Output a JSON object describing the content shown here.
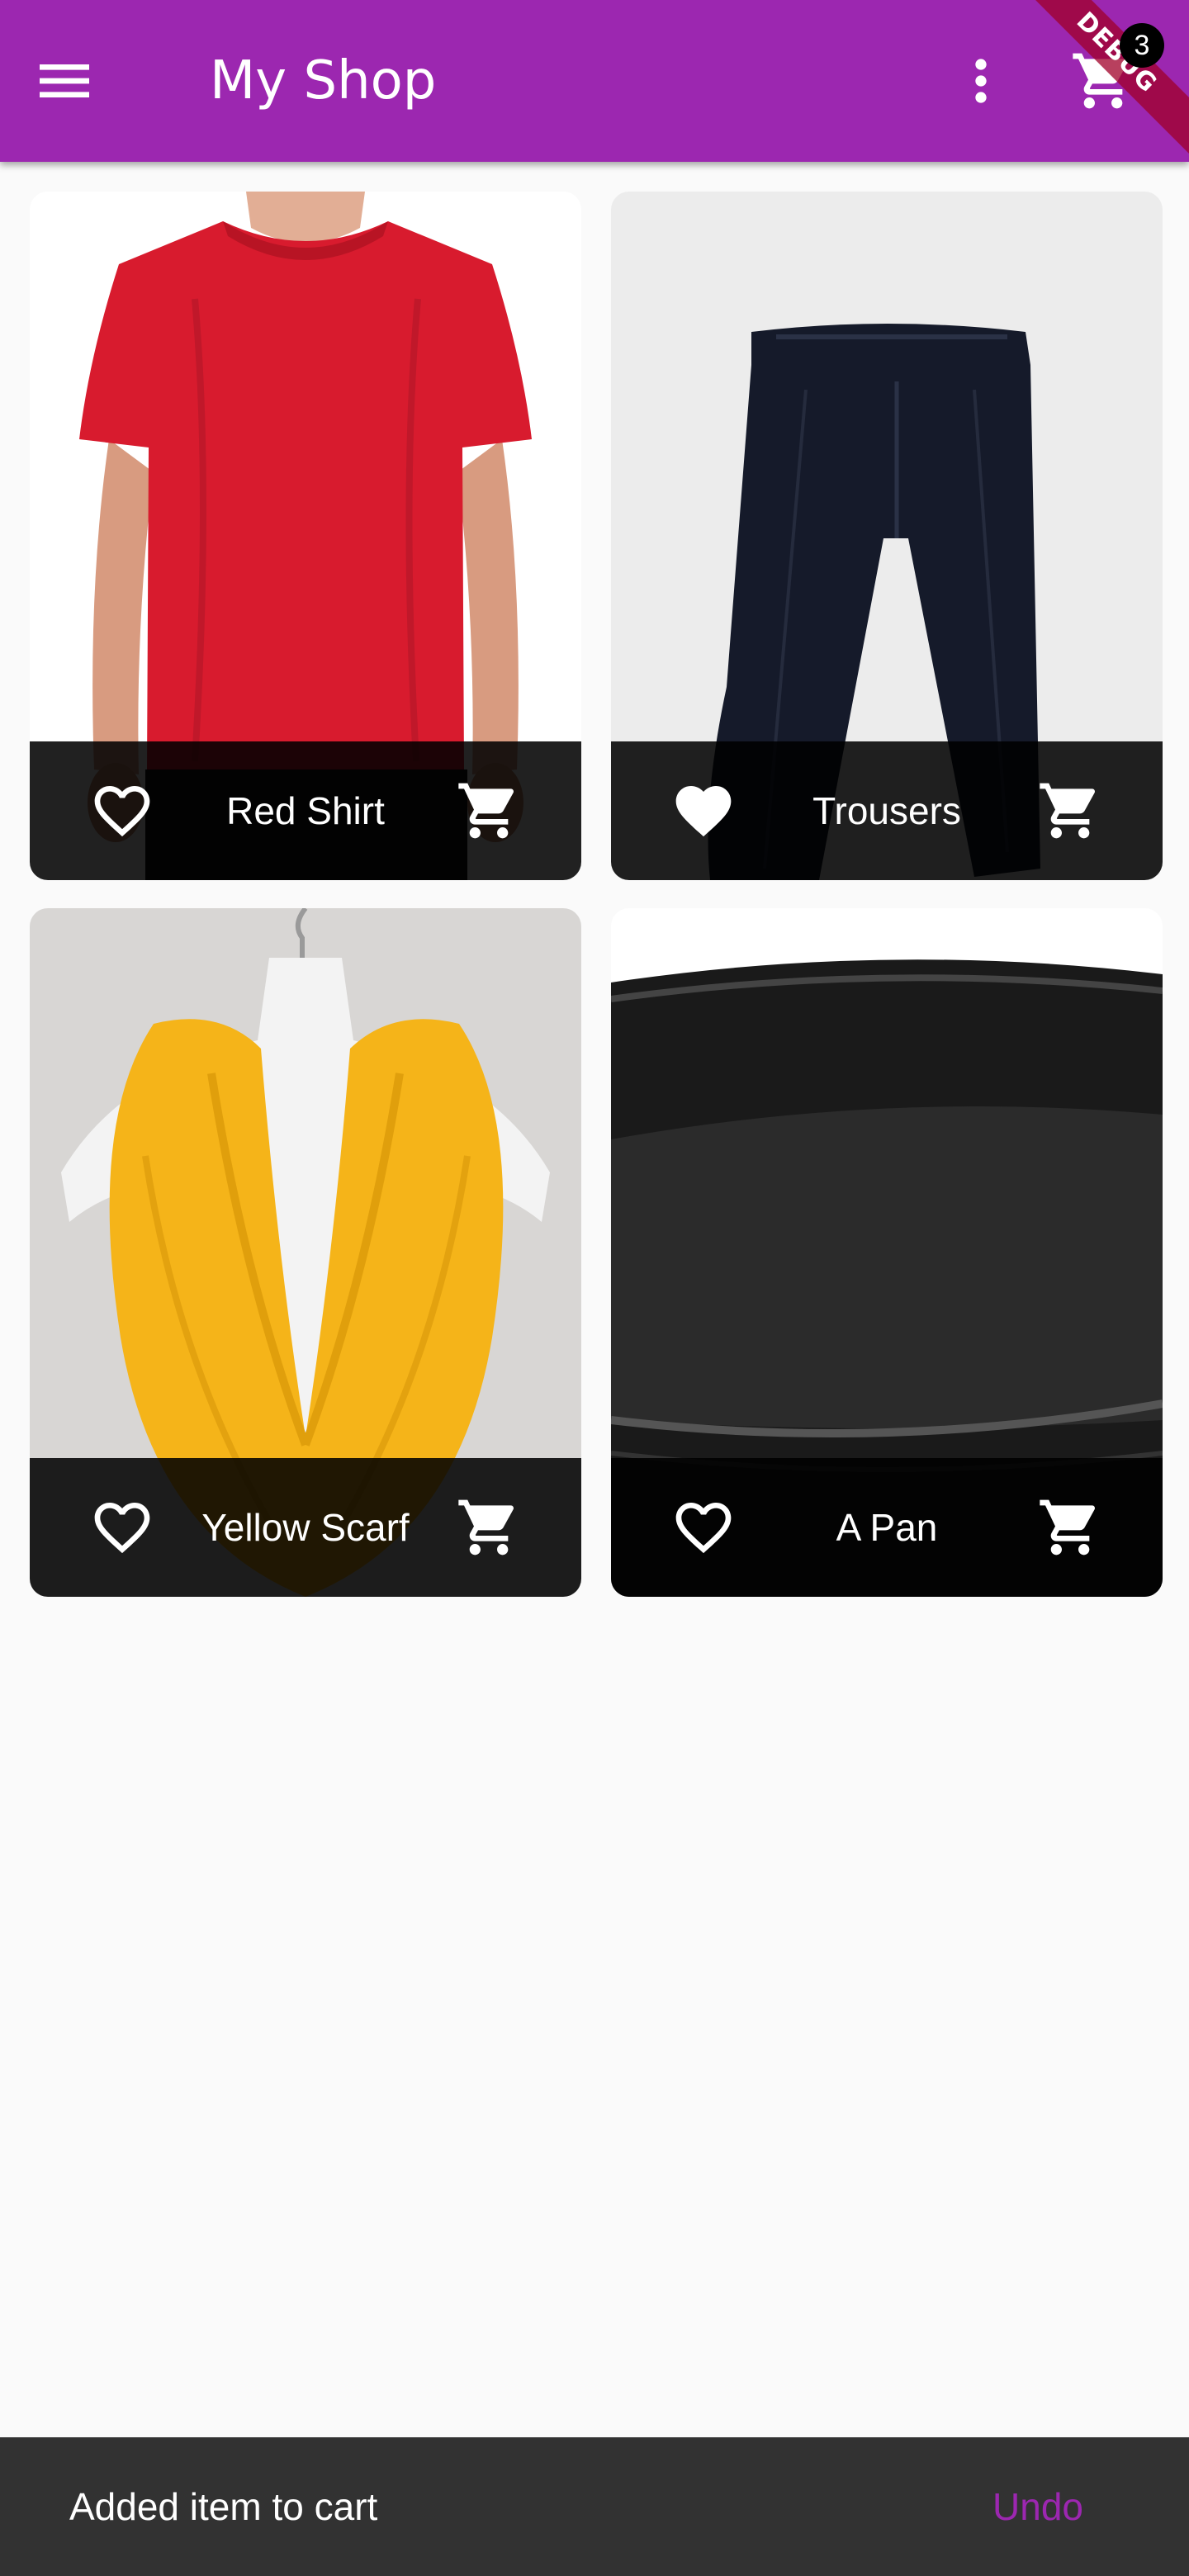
{
  "app_bar": {
    "title": "My Shop",
    "menu_icon": "menu-icon",
    "more_icon": "more-vert-icon",
    "cart_icon": "shopping-cart-icon",
    "cart_badge_count": "3",
    "background_color": "#9c27b0",
    "debug_banner": "DEBUG"
  },
  "products": [
    {
      "title": "Red Shirt",
      "favorite": false,
      "image": "red-shirt-photo"
    },
    {
      "title": "Trousers",
      "favorite": true,
      "image": "trousers-photo"
    },
    {
      "title": "Yellow Scarf",
      "favorite": false,
      "image": "yellow-scarf-photo"
    },
    {
      "title": "A Pan",
      "favorite": false,
      "image": "pan-photo"
    }
  ],
  "snackbar": {
    "message": "Added item to cart",
    "action": "Undo",
    "action_color": "#9c27b0"
  }
}
